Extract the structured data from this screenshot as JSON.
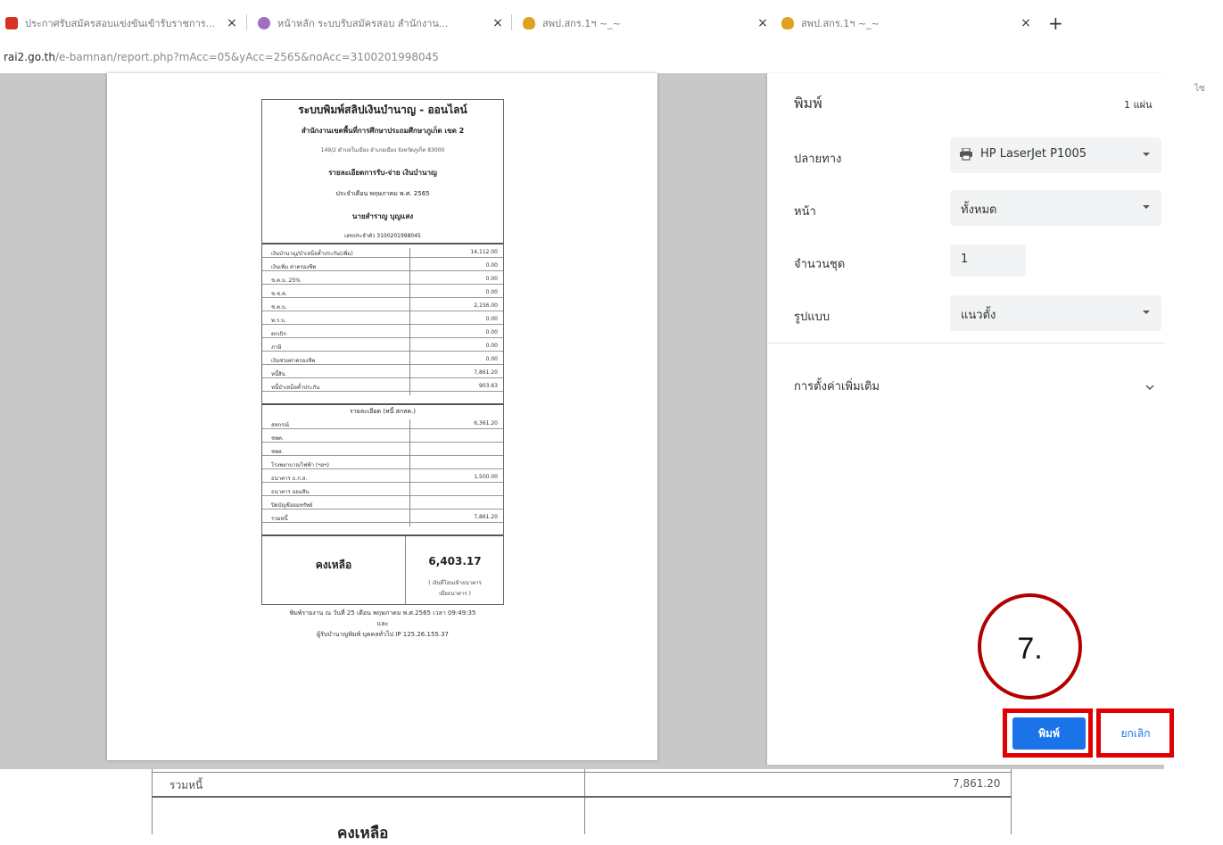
{
  "browser": {
    "tabs": [
      {
        "title": "ประกาศรับสมัครสอบแข่งขันเข้ารับราชการ...",
        "favicon_color": "#d93025"
      },
      {
        "title": "หน้าหลัก ระบบรับสมัครสอบ สำนักงาน...",
        "favicon_color": "#a070c0"
      },
      {
        "title": "สพป.สกร.1ฯ ~_~",
        "favicon_color": "#e0a020"
      },
      {
        "title": "สพป.สกร.1ฯ ~_~",
        "favicon_color": "#e0a020"
      }
    ],
    "close_glyph": "×",
    "new_tab_glyph": "+",
    "url_host": "rai2.go.th",
    "url_rest": "/e-bamnan/report.php?mAcc=05&yAcc=2565&noAcc=3100201998045"
  },
  "receipt": {
    "title": "ระบบพิมพ์สลิปเงินบำนาญ - ออนไลน์",
    "org": "สำนักงานเขตพื้นที่การศึกษาประถมศึกษาภูเก็ต เขต 2",
    "address": "149/2 ตำบลในเมือง อำเภอเมือง จังหวัดภูเก็ต 83000",
    "doc_title": "รายละเอียดการรับ-จ่าย เงินบำนาญ",
    "period": "ประจำเดือน พฤษภาคม พ.ศ. 2565",
    "name": "นายสำราญ บุญแสง",
    "id_line": "เลขประจำตัว 3100201998045",
    "income_rows": [
      {
        "label": "เงินบำนาญ/บำเหน็จค้ำประกัน(เพิ่ม)",
        "value": "14,112.00"
      },
      {
        "label": "เงินเพิ่ม ค่าครองชีพ",
        "value": "0.00"
      },
      {
        "label": "ช.ค.บ. 25%",
        "value": "0.00"
      },
      {
        "label": "ช.ช.ค.",
        "value": "0.00"
      },
      {
        "label": "ช.ค.บ.",
        "value": "2,156.00"
      },
      {
        "label": "พ.ร.บ.",
        "value": "0.00"
      },
      {
        "label": "ตกเบิก",
        "value": "0.00"
      },
      {
        "label": "ภาษี",
        "value": "0.00"
      },
      {
        "label": "เงินช่วยค่าครองชีพ",
        "value": "0.00"
      },
      {
        "label": "หนี้สิน",
        "value": "7,861.20"
      },
      {
        "label": "หนี้บำเหน็จค้ำประกัน",
        "value": "903.63"
      }
    ],
    "deduct_header": "รายละเอียด (หนี้ สกสค.)",
    "deduct_rows": [
      {
        "label": "สหกรณ์",
        "value": "6,361.20"
      },
      {
        "label": "ชพค.",
        "value": ""
      },
      {
        "label": "ชพส.",
        "value": ""
      },
      {
        "label": "โรงพยาบาล/ไฟฟ้า (ฯลฯ)",
        "value": ""
      },
      {
        "label": "ธนาคาร ธ.ก.ส.",
        "value": "1,500.00"
      },
      {
        "label": "ธนาคาร ออมสิน",
        "value": ""
      },
      {
        "label": "ปิดบัญชีออมทรัพย์",
        "value": ""
      },
      {
        "label": "รวมหนี้",
        "value": "7,861.20"
      }
    ],
    "net_label": "คงเหลือ",
    "net_value": "6,403.17",
    "net_note_1": "( เงินที่โอนเข้าธนาคาร",
    "net_note_2": "เมื่อธนาคาร )",
    "footer_1": "พิมพ์รายงาน ณ วันที่ 25 เดือน พฤษภาคม พ.ศ.2565 เวลา 09:49:35",
    "footer_2": "และ",
    "footer_3": "ผู้รับบำนาญพิมพ์ บุคคลทั่วไป IP 125.26.155.37"
  },
  "print_dialog": {
    "title": "พิมพ์",
    "sheet_count": "1 แผ่น",
    "destination_label": "ปลายทาง",
    "destination_value": "HP LaserJet P1005",
    "pages_label": "หน้า",
    "pages_value": "ทั้งหมด",
    "copies_label": "จำนวนชุด",
    "copies_value": "1",
    "layout_label": "รูปแบบ",
    "layout_value": "แนวตั้ง",
    "more_settings_label": "การตั้งค่าเพิ่มเติม",
    "print_button": "พิมพ์",
    "cancel_button": "ยกเลิก",
    "step_label": "7.",
    "highlight_color": "#e00000",
    "accent_color": "#1a73e8"
  },
  "behind_page": {
    "row_label": "รวมหนี้",
    "row_value": "7,861.20",
    "net_label": "คงเหลือ",
    "side_char": "ไซ"
  }
}
